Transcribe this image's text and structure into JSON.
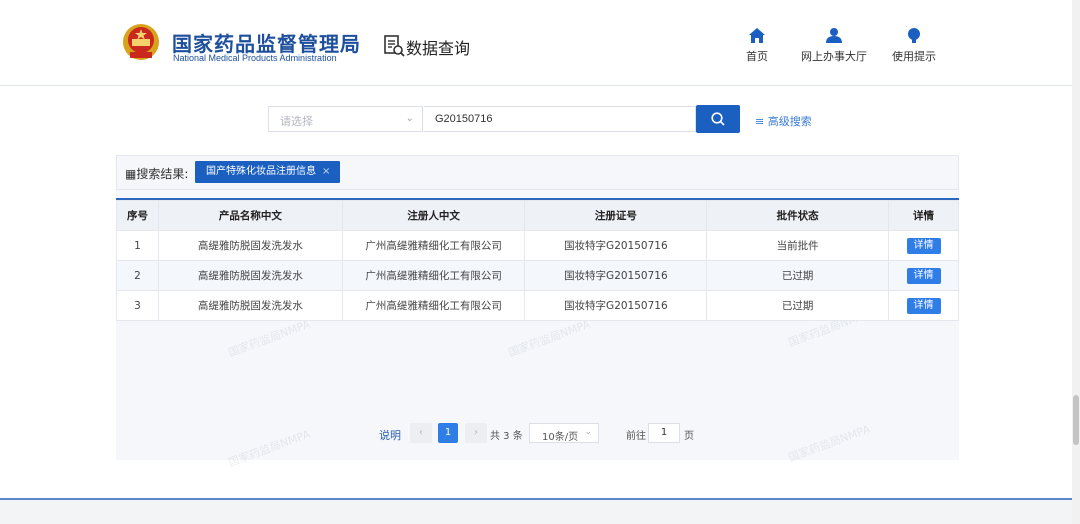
{
  "header": {
    "org_name_cn": "国家药品监督管理局",
    "org_name_en": "National Medical Products Administration",
    "section_title": "数据查询",
    "nav": [
      {
        "label": "首页",
        "icon": "home-icon"
      },
      {
        "label": "网上办事大厅",
        "icon": "user-icon"
      },
      {
        "label": "使用提示",
        "icon": "bulb-icon"
      }
    ]
  },
  "search": {
    "select_placeholder": "请选择",
    "query_value": "G20150716",
    "advanced_label": "高级搜索"
  },
  "results": {
    "label": "搜索结果:",
    "tag": "国产特殊化妆品注册信息",
    "columns": [
      "序号",
      "产品名称中文",
      "注册人中文",
      "注册证号",
      "批件状态",
      "详情"
    ],
    "rows": [
      {
        "no": "1",
        "product": "高缇雅防脱固发洗发水",
        "registrant": "广州高缇雅精细化工有限公司",
        "cert": "国妆特字G20150716",
        "status": "当前批件",
        "detail": "详情"
      },
      {
        "no": "2",
        "product": "高缇雅防脱固发洗发水",
        "registrant": "广州高缇雅精细化工有限公司",
        "cert": "国妆特字G20150716",
        "status": "已过期",
        "detail": "详情"
      },
      {
        "no": "3",
        "product": "高缇雅防脱固发洗发水",
        "registrant": "广州高缇雅精细化工有限公司",
        "cert": "国妆特字G20150716",
        "status": "已过期",
        "detail": "详情"
      }
    ],
    "watermark": "国家药监局NMPA"
  },
  "pagination": {
    "note": "说明",
    "current_page": "1",
    "total": "共 3 条",
    "page_size": "10条/页",
    "goto_label": "前往",
    "goto_value": "1",
    "page_suffix": "页"
  },
  "colors": {
    "brand_blue": "#1b5fc1",
    "header_text": "#1d4f9c",
    "accent_link": "#3a7bd5"
  }
}
